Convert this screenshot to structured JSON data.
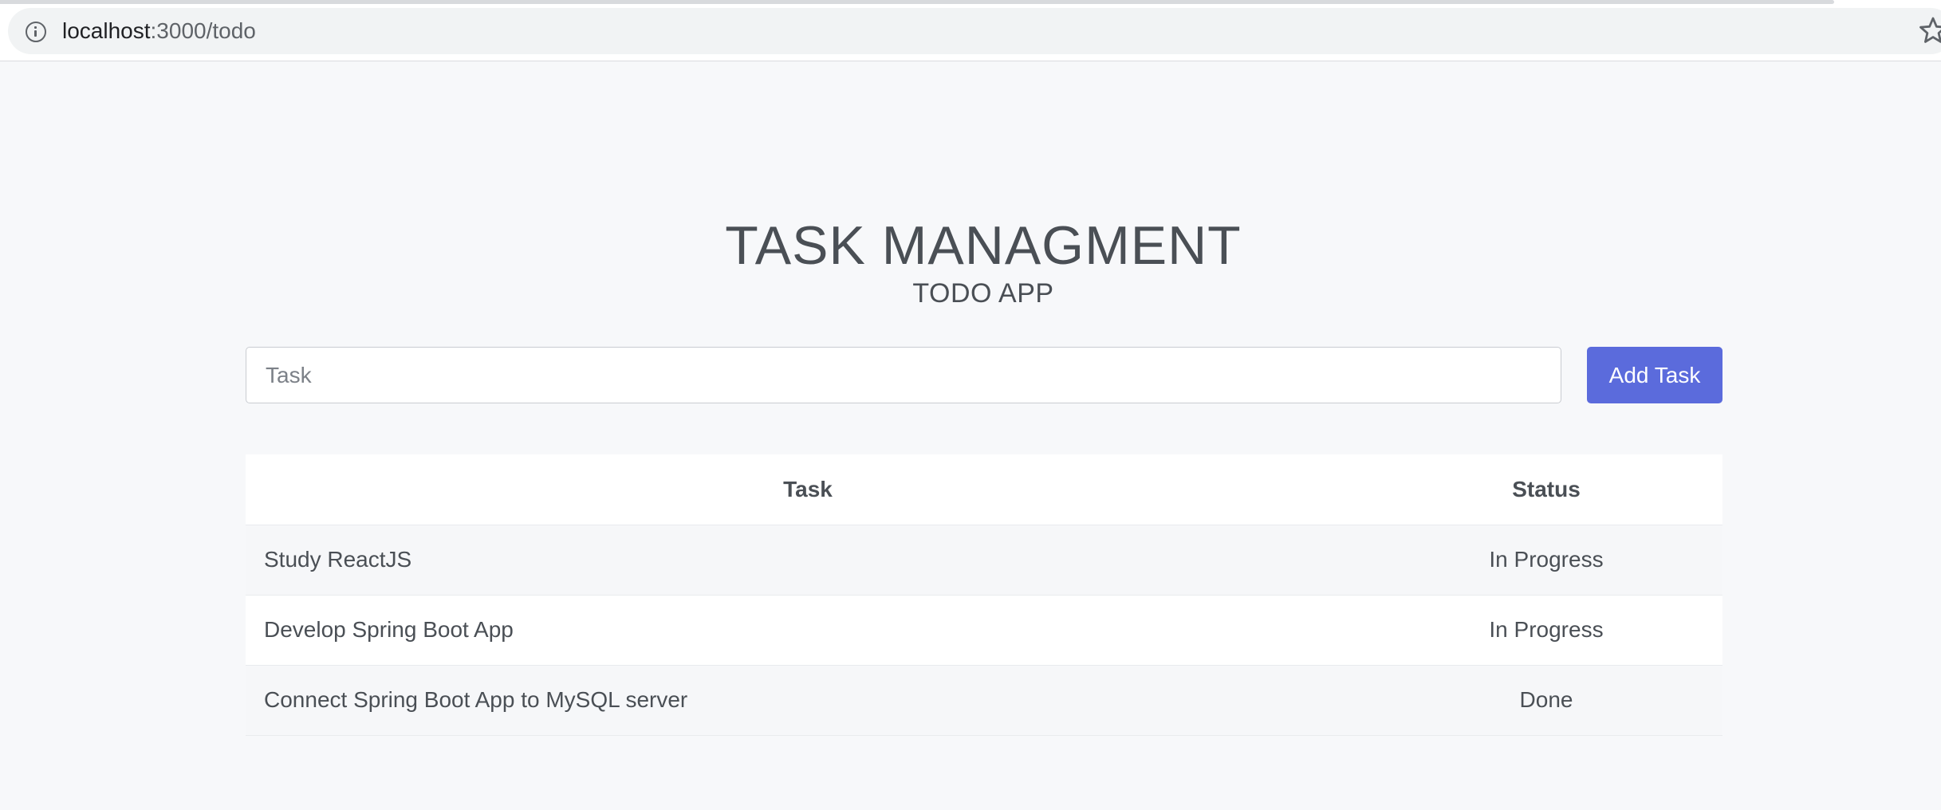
{
  "browser": {
    "url_host": "localhost",
    "url_path": ":3000/todo"
  },
  "header": {
    "title": "TASK MANAGMENT",
    "subtitle": "TODO APP"
  },
  "form": {
    "input_placeholder": "Task",
    "input_value": "",
    "add_button_label": "Add Task"
  },
  "table": {
    "columns": [
      "Task",
      "Status"
    ],
    "rows": [
      {
        "task": "Study ReactJS",
        "status": "In Progress"
      },
      {
        "task": "Develop Spring Boot App",
        "status": "In Progress"
      },
      {
        "task": "Connect Spring Boot App to MySQL server",
        "status": "Done"
      }
    ]
  },
  "colors": {
    "accent": "#5b6bdc",
    "background": "#f7f8fa",
    "text": "#4a4f55"
  }
}
